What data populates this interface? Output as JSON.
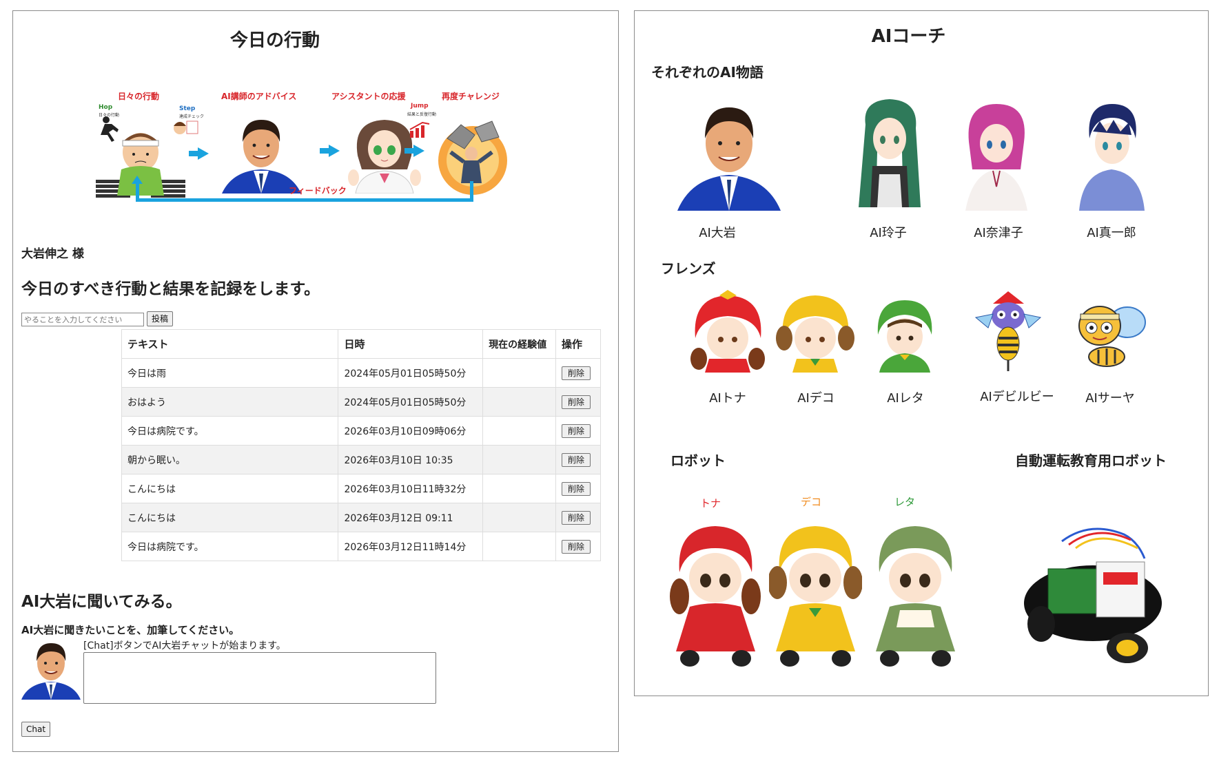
{
  "left": {
    "title": "今日の行動",
    "flow": {
      "step1": "日々の行動",
      "step2": "AI講師のアドバイス",
      "step3": "アシスタントの応援",
      "step4": "再度チャレンジ",
      "hop": "Hop",
      "hop_sub": "日々の行動",
      "step": "Step",
      "step_sub": "達成チェック",
      "jump": "Jump",
      "jump_sub": "結果と反復行動",
      "feedback": "フィードバック"
    },
    "user_name": "大岩伸之 様",
    "heading": "今日のすべき行動と結果を記録をします。",
    "task_placeholder": "やることを入力してください",
    "post_button": "投稿",
    "table": {
      "headers": [
        "テキスト",
        "日時",
        "現在の経験値",
        "操作"
      ],
      "rows": [
        {
          "text": "今日は雨",
          "date": "2024年05月01日05時50分",
          "exp": "",
          "action": "削除"
        },
        {
          "text": "おはよう",
          "date": "2024年05月01日05時50分",
          "exp": "",
          "action": "削除"
        },
        {
          "text": "今日は病院です。",
          "date": "2026年03月10日09時06分",
          "exp": "",
          "action": "削除"
        },
        {
          "text": "朝から眠い。",
          "date": "2026年03月10日 10:35",
          "exp": "",
          "action": "削除"
        },
        {
          "text": "こんにちは",
          "date": "2026年03月10日11時32分",
          "exp": "",
          "action": "削除"
        },
        {
          "text": "こんにちは",
          "date": "2026年03月12日 09:11",
          "exp": "",
          "action": "削除"
        },
        {
          "text": "今日は病院です。",
          "date": "2026年03月12日11時14分",
          "exp": "",
          "action": "削除"
        }
      ]
    },
    "ask_heading": "AI大岩に聞いてみる。",
    "ask_sub": "AI大岩に聞きたいことを、加筆してください。",
    "chat_hint": "[Chat]ボタンでAI大岩チャットが始まります。",
    "chat_button": "Chat"
  },
  "right": {
    "title": "AIコーチ",
    "section_story": "それぞれのAI物語",
    "coaches": [
      "AI大岩",
      "AI玲子",
      "AI奈津子",
      "AI真一郎"
    ],
    "section_friends": "フレンズ",
    "friends": [
      "AIトナ",
      "AIデコ",
      "AIレタ",
      "AIデビルビー",
      "AIサーヤ"
    ],
    "section_robot": "ロボット",
    "section_auto": "自動運転教育用ロボット",
    "robots": [
      "トナ",
      "デコ",
      "レタ"
    ]
  },
  "colors": {
    "flow_red": "#d8262b",
    "flow_blue": "#1aa3de",
    "robot_tona": "#e0262b",
    "robot_deko": "#f08a1c",
    "robot_reta": "#2f9a3a"
  }
}
